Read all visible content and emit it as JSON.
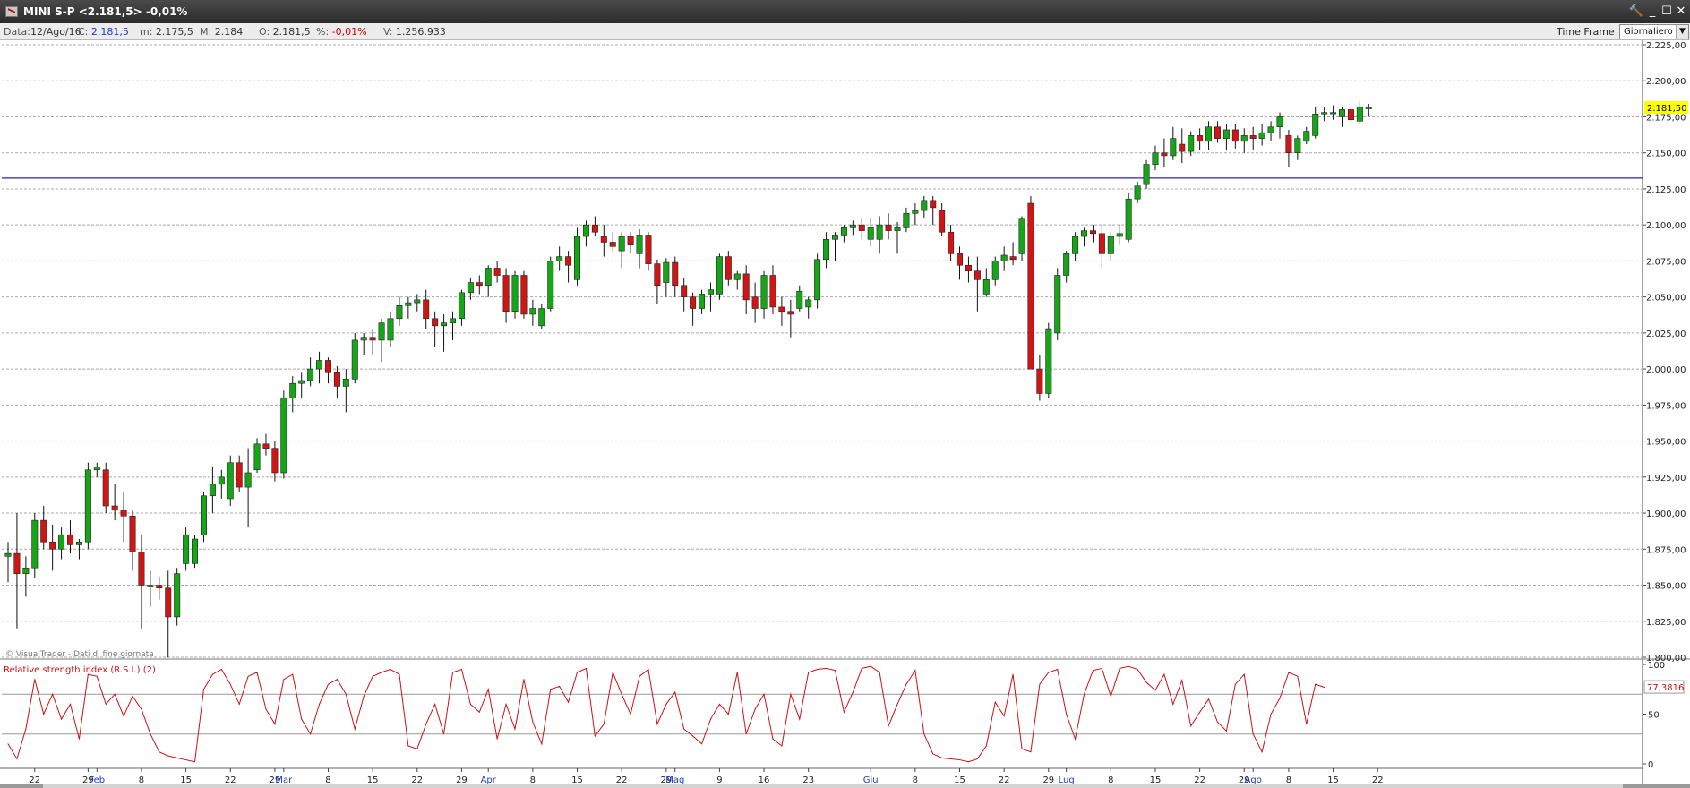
{
  "window": {
    "title": "MINI S-P <2.181,5> -0,01%",
    "buttons": [
      "🔨",
      "_",
      "☐",
      "✕"
    ]
  },
  "infobar": {
    "date_label": "Data:",
    "date_value": "12/Ago/16",
    "close_label": "C:",
    "close_value": "2.181,5",
    "min_label": "m:",
    "min_value": "2.175,5",
    "max_label": "M:",
    "max_value": "2.184",
    "open_label": "O:",
    "open_value": "2.181,5",
    "pct_label": "%:",
    "pct_value": "-0,01%",
    "vol_label": "V:",
    "vol_value": "1.256.933",
    "timeframe_label": "Time Frame",
    "timeframe_value": "Giornaliero"
  },
  "colors": {
    "up": "#16a516",
    "down": "#d11515",
    "wick": "#111111",
    "grid": "#a8a8a8",
    "hline": "#2222c8",
    "rsi": "#cc1111",
    "price_badge": "#ffff00"
  },
  "chart_data": [
    {
      "type": "candlestick",
      "title": "MINI S-P",
      "watermark": "© VisualTrader - Dati di fine giornata",
      "ylim": [
        1800,
        2225
      ],
      "y_ticks": [
        1800,
        1825,
        1850,
        1875,
        1900,
        1925,
        1950,
        1975,
        2000,
        2025,
        2050,
        2075,
        2100,
        2125,
        2150,
        2175,
        2200,
        2225
      ],
      "y_tick_labels": [
        "1.800,00",
        "1.825,00",
        "1.850,00",
        "1.875,00",
        "1.900,00",
        "1.925,00",
        "1.950,00",
        "1.975,00",
        "2.000,00",
        "2.025,00",
        "2.050,00",
        "2.075,00",
        "2.100,00",
        "2.125,00",
        "2.150,00",
        "2.175,00",
        "2.200,00",
        "2.225,00"
      ],
      "horizontal_line": 2132.5,
      "last_price": 2181.5,
      "last_price_label": "2.181,50",
      "x_labels": [
        {
          "bar": 3,
          "text": "22"
        },
        {
          "bar": 9,
          "text": "29"
        },
        {
          "bar": 10,
          "text": "Feb",
          "month": true
        },
        {
          "bar": 15,
          "text": "8"
        },
        {
          "bar": 20,
          "text": "15"
        },
        {
          "bar": 25,
          "text": "22"
        },
        {
          "bar": 30,
          "text": "29"
        },
        {
          "bar": 31,
          "text": "Mar",
          "month": true
        },
        {
          "bar": 36,
          "text": "8"
        },
        {
          "bar": 41,
          "text": "15"
        },
        {
          "bar": 46,
          "text": "22"
        },
        {
          "bar": 51,
          "text": "29"
        },
        {
          "bar": 54,
          "text": "Apr",
          "month": true
        },
        {
          "bar": 59,
          "text": "8"
        },
        {
          "bar": 64,
          "text": "15"
        },
        {
          "bar": 69,
          "text": "22"
        },
        {
          "bar": 74,
          "text": "29"
        },
        {
          "bar": 75,
          "text": "Mag",
          "month": true
        },
        {
          "bar": 80,
          "text": "9"
        },
        {
          "bar": 85,
          "text": "16"
        },
        {
          "bar": 90,
          "text": "23"
        },
        {
          "bar": 97,
          "text": "Giu",
          "month": true
        },
        {
          "bar": 102,
          "text": "8"
        },
        {
          "bar": 107,
          "text": "15"
        },
        {
          "bar": 112,
          "text": "22"
        },
        {
          "bar": 117,
          "text": "29"
        },
        {
          "bar": 119,
          "text": "Lug",
          "month": true
        },
        {
          "bar": 124,
          "text": "8"
        },
        {
          "bar": 129,
          "text": "15"
        },
        {
          "bar": 134,
          "text": "22"
        },
        {
          "bar": 139,
          "text": "29"
        },
        {
          "bar": 140,
          "text": "Ago",
          "month": true
        },
        {
          "bar": 144,
          "text": "8"
        },
        {
          "bar": 149,
          "text": "15"
        },
        {
          "bar": 154,
          "text": "22"
        }
      ],
      "candles": [
        [
          1870,
          1880,
          1852,
          1872
        ],
        [
          1872,
          1900,
          1820,
          1858
        ],
        [
          1858,
          1870,
          1842,
          1862
        ],
        [
          1862,
          1900,
          1855,
          1895
        ],
        [
          1895,
          1905,
          1875,
          1880
        ],
        [
          1880,
          1892,
          1860,
          1875
        ],
        [
          1875,
          1890,
          1868,
          1885
        ],
        [
          1885,
          1895,
          1872,
          1878
        ],
        [
          1878,
          1882,
          1868,
          1880
        ],
        [
          1880,
          1935,
          1875,
          1930
        ],
        [
          1930,
          1935,
          1925,
          1932
        ],
        [
          1930,
          1935,
          1900,
          1905
        ],
        [
          1905,
          1920,
          1895,
          1902
        ],
        [
          1902,
          1915,
          1880,
          1898
        ],
        [
          1898,
          1902,
          1860,
          1873
        ],
        [
          1873,
          1885,
          1820,
          1850
        ],
        [
          1850,
          1860,
          1835,
          1850
        ],
        [
          1850,
          1856,
          1840,
          1848
        ],
        [
          1848,
          1860,
          1800,
          1828
        ],
        [
          1828,
          1862,
          1822,
          1858
        ],
        [
          1865,
          1890,
          1860,
          1885
        ],
        [
          1865,
          1885,
          1862,
          1882
        ],
        [
          1885,
          1915,
          1880,
          1912
        ],
        [
          1912,
          1932,
          1900,
          1920
        ],
        [
          1920,
          1930,
          1910,
          1925
        ],
        [
          1910,
          1940,
          1905,
          1935
        ],
        [
          1935,
          1940,
          1915,
          1918
        ],
        [
          1918,
          1945,
          1890,
          1928
        ],
        [
          1930,
          1952,
          1928,
          1948
        ],
        [
          1948,
          1955,
          1940,
          1945
        ],
        [
          1945,
          1950,
          1922,
          1928
        ],
        [
          1928,
          1985,
          1924,
          1980
        ],
        [
          1980,
          1995,
          1970,
          1990
        ],
        [
          1990,
          1998,
          1980,
          1992
        ],
        [
          1992,
          2008,
          1988,
          2000
        ],
        [
          2000,
          2012,
          1990,
          2006
        ],
        [
          2006,
          2008,
          1990,
          1998
        ],
        [
          1998,
          2002,
          1980,
          1988
        ],
        [
          1988,
          2000,
          1970,
          1993
        ],
        [
          1993,
          2025,
          1990,
          2020
        ],
        [
          2020,
          2025,
          2010,
          2022
        ],
        [
          2022,
          2028,
          2010,
          2020
        ],
        [
          2020,
          2035,
          2005,
          2032
        ],
        [
          2020,
          2040,
          2015,
          2035
        ],
        [
          2035,
          2050,
          2030,
          2044
        ],
        [
          2044,
          2050,
          2035,
          2046
        ],
        [
          2046,
          2052,
          2040,
          2048
        ],
        [
          2048,
          2055,
          2028,
          2035
        ],
        [
          2035,
          2040,
          2015,
          2030
        ],
        [
          2030,
          2038,
          2012,
          2032
        ],
        [
          2032,
          2040,
          2020,
          2035
        ],
        [
          2035,
          2055,
          2030,
          2053
        ],
        [
          2053,
          2063,
          2048,
          2060
        ],
        [
          2060,
          2065,
          2052,
          2058
        ],
        [
          2058,
          2072,
          2050,
          2070
        ],
        [
          2070,
          2075,
          2060,
          2065
        ],
        [
          2065,
          2070,
          2032,
          2040
        ],
        [
          2040,
          2068,
          2035,
          2065
        ],
        [
          2065,
          2068,
          2035,
          2038
        ],
        [
          2038,
          2048,
          2030,
          2042
        ],
        [
          2030,
          2045,
          2028,
          2042
        ],
        [
          2042,
          2078,
          2040,
          2075
        ],
        [
          2075,
          2085,
          2068,
          2078
        ],
        [
          2078,
          2082,
          2060,
          2072
        ],
        [
          2062,
          2098,
          2058,
          2092
        ],
        [
          2092,
          2103,
          2085,
          2100
        ],
        [
          2100,
          2106,
          2092,
          2095
        ],
        [
          2092,
          2100,
          2078,
          2088
        ],
        [
          2088,
          2095,
          2082,
          2085
        ],
        [
          2082,
          2095,
          2070,
          2092
        ],
        [
          2092,
          2095,
          2080,
          2086
        ],
        [
          2080,
          2097,
          2070,
          2093
        ],
        [
          2093,
          2095,
          2068,
          2073
        ],
        [
          2073,
          2076,
          2045,
          2058
        ],
        [
          2060,
          2077,
          2050,
          2074
        ],
        [
          2074,
          2078,
          2050,
          2058
        ],
        [
          2058,
          2063,
          2040,
          2050
        ],
        [
          2050,
          2053,
          2030,
          2042
        ],
        [
          2042,
          2055,
          2038,
          2052
        ],
        [
          2052,
          2060,
          2040,
          2055
        ],
        [
          2052,
          2080,
          2048,
          2078
        ],
        [
          2078,
          2082,
          2058,
          2062
        ],
        [
          2062,
          2068,
          2055,
          2066
        ],
        [
          2066,
          2072,
          2038,
          2048
        ],
        [
          2050,
          2060,
          2032,
          2042
        ],
        [
          2042,
          2068,
          2035,
          2065
        ],
        [
          2065,
          2072,
          2038,
          2043
        ],
        [
          2043,
          2050,
          2030,
          2040
        ],
        [
          2040,
          2048,
          2022,
          2038
        ],
        [
          2042,
          2058,
          2040,
          2054
        ],
        [
          2043,
          2050,
          2035,
          2048
        ],
        [
          2048,
          2080,
          2042,
          2076
        ],
        [
          2076,
          2095,
          2070,
          2090
        ],
        [
          2090,
          2095,
          2075,
          2093
        ],
        [
          2093,
          2100,
          2088,
          2098
        ],
        [
          2098,
          2103,
          2093,
          2100
        ],
        [
          2100,
          2105,
          2090,
          2096
        ],
        [
          2090,
          2105,
          2085,
          2098
        ],
        [
          2090,
          2106,
          2080,
          2100
        ],
        [
          2100,
          2108,
          2090,
          2096
        ],
        [
          2096,
          2102,
          2080,
          2098
        ],
        [
          2098,
          2112,
          2095,
          2108
        ],
        [
          2108,
          2115,
          2100,
          2110
        ],
        [
          2110,
          2120,
          2105,
          2117
        ],
        [
          2117,
          2120,
          2100,
          2112
        ],
        [
          2110,
          2115,
          2092,
          2095
        ],
        [
          2095,
          2100,
          2075,
          2080
        ],
        [
          2080,
          2085,
          2062,
          2072
        ],
        [
          2072,
          2078,
          2060,
          2068
        ],
        [
          2068,
          2078,
          2040,
          2062
        ],
        [
          2052,
          2070,
          2050,
          2062
        ],
        [
          2062,
          2078,
          2058,
          2075
        ],
        [
          2075,
          2085,
          2068,
          2079
        ],
        [
          2078,
          2088,
          2072,
          2076
        ],
        [
          2080,
          2106,
          2075,
          2104
        ],
        [
          2115,
          2120,
          2010,
          2000
        ],
        [
          2000,
          2010,
          1978,
          1983
        ],
        [
          1983,
          2032,
          1980,
          2028
        ],
        [
          2025,
          2070,
          2020,
          2065
        ],
        [
          2065,
          2082,
          2060,
          2080
        ],
        [
          2080,
          2095,
          2075,
          2092
        ],
        [
          2092,
          2098,
          2085,
          2096
        ],
        [
          2096,
          2100,
          2088,
          2094
        ],
        [
          2094,
          2100,
          2070,
          2080
        ],
        [
          2080,
          2095,
          2075,
          2092
        ],
        [
          2092,
          2100,
          2086,
          2094
        ],
        [
          2090,
          2122,
          2088,
          2118
        ],
        [
          2118,
          2130,
          2115,
          2127
        ],
        [
          2128,
          2145,
          2125,
          2142
        ],
        [
          2142,
          2155,
          2138,
          2150
        ],
        [
          2150,
          2160,
          2140,
          2148
        ],
        [
          2148,
          2168,
          2145,
          2160
        ],
        [
          2156,
          2167,
          2143,
          2151
        ],
        [
          2151,
          2165,
          2148,
          2162
        ],
        [
          2162,
          2167,
          2152,
          2158
        ],
        [
          2158,
          2172,
          2152,
          2168
        ],
        [
          2168,
          2172,
          2157,
          2160
        ],
        [
          2160,
          2170,
          2152,
          2166
        ],
        [
          2166,
          2170,
          2153,
          2158
        ],
        [
          2158,
          2167,
          2150,
          2162
        ],
        [
          2162,
          2168,
          2152,
          2160
        ],
        [
          2160,
          2170,
          2155,
          2164
        ],
        [
          2164,
          2172,
          2158,
          2168
        ],
        [
          2168,
          2178,
          2160,
          2175
        ],
        [
          2162,
          2166,
          2140,
          2150
        ],
        [
          2150,
          2162,
          2145,
          2160
        ],
        [
          2158,
          2168,
          2156,
          2165
        ],
        [
          2162,
          2182,
          2160,
          2177
        ],
        [
          2177,
          2182,
          2172,
          2178
        ],
        [
          2178,
          2183,
          2173,
          2178
        ],
        [
          2175,
          2182,
          2168,
          2180
        ],
        [
          2180,
          2182,
          2170,
          2173
        ],
        [
          2172,
          2186,
          2170,
          2182
        ],
        [
          2181.5,
          2184,
          2175.5,
          2181.5
        ]
      ]
    },
    {
      "type": "line",
      "title": "Relative strength index (R.S.I.) (2)",
      "ylim": [
        0,
        100
      ],
      "y_ticks": [
        0,
        50,
        100
      ],
      "y_tick_labels": [
        "0",
        "50",
        "100"
      ],
      "reference_lines": [
        30,
        70
      ],
      "last_value": 77.3816,
      "last_value_label": "77,3816",
      "values": [
        20,
        5,
        35,
        85,
        50,
        70,
        45,
        60,
        25,
        90,
        88,
        60,
        70,
        48,
        68,
        55,
        30,
        12,
        8,
        6,
        4,
        2,
        75,
        90,
        95,
        80,
        60,
        88,
        92,
        55,
        40,
        85,
        90,
        45,
        30,
        60,
        80,
        85,
        70,
        35,
        68,
        88,
        92,
        95,
        90,
        18,
        15,
        40,
        60,
        30,
        92,
        95,
        60,
        52,
        75,
        25,
        60,
        35,
        85,
        42,
        20,
        75,
        78,
        62,
        92,
        96,
        28,
        40,
        92,
        70,
        50,
        88,
        95,
        40,
        60,
        72,
        35,
        28,
        20,
        45,
        60,
        50,
        92,
        30,
        55,
        70,
        25,
        18,
        70,
        45,
        92,
        95,
        96,
        94,
        52,
        72,
        96,
        98,
        92,
        38,
        60,
        80,
        94,
        30,
        10,
        6,
        5,
        4,
        2,
        5,
        18,
        62,
        48,
        90,
        15,
        12,
        80,
        92,
        95,
        50,
        25,
        70,
        94,
        96,
        68,
        96,
        98,
        95,
        82,
        74,
        90,
        60,
        84,
        38,
        52,
        65,
        42,
        33,
        80,
        90,
        30,
        12,
        50,
        66,
        92,
        88,
        40,
        80,
        77
      ]
    }
  ]
}
